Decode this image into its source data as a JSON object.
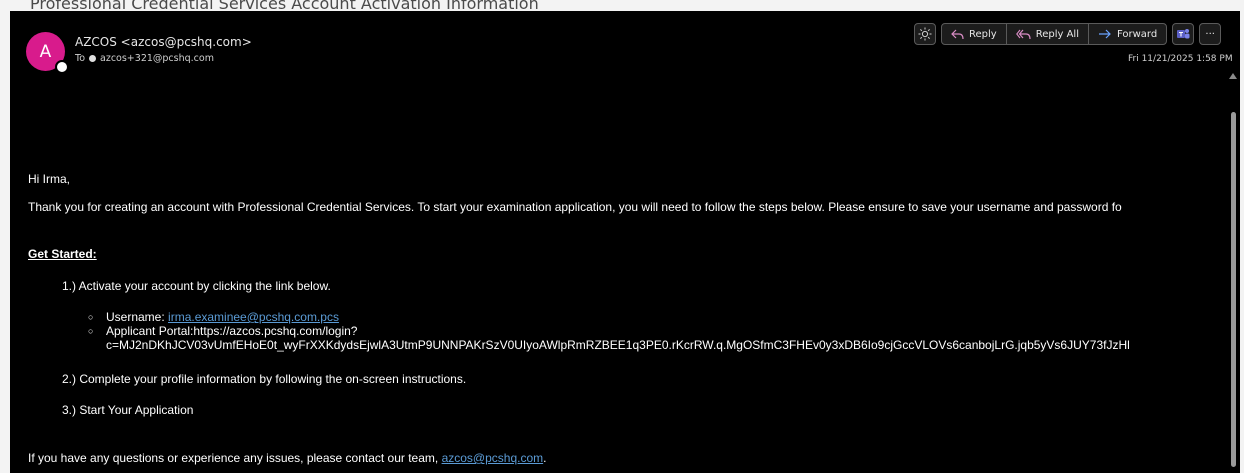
{
  "window_title": "Professional Credential Services Account Activation Information",
  "header": {
    "avatar_letter": "A",
    "from": "AZCOS <azcos@pcshq.com>",
    "to_label": "To",
    "to_address": "azcos+321@pcshq.com",
    "date": "Fri 11/21/2025 1:58 PM"
  },
  "toolbar": {
    "reply": "Reply",
    "reply_all": "Reply All",
    "forward": "Forward",
    "more": "···"
  },
  "body": {
    "greeting": "Hi Irma,",
    "intro": "Thank you for creating an account with Professional Credential Services. To start your examination application, you will need to follow the steps below. Please ensure to save your username and password fo",
    "get_started": "Get Started:",
    "step1": "1.) Activate your account by clicking the link below.",
    "username_label": "Username: ",
    "username_link": "irma.examinee@pcshq.com.pcs",
    "portal_line1": "Applicant Portal:https://azcos.pcshq.com/login?",
    "portal_line2": "c=MJ2nDKhJCV03vUmfEHoE0t_wyFrXXKdydsEjwlA3UtmP9UNNPAKrSzV0UIyoAWlpRmRZBEE1q3PE0.rKcrRW.q.MgOSfmC3FHEv0y3xDB6Io9cjGccVLOVs6canbojLrG.jqb5yVs6JUY73fJzHl",
    "step2": "2.) Complete your profile information by following the on-screen instructions.",
    "step3": "3.) Start Your Application",
    "contact_text": "If you have any questions or experience any issues, please contact our team, ",
    "contact_link": "azcos@pcshq.com",
    "contact_end": "."
  },
  "colors": {
    "avatar": "#d81b8c",
    "link": "#5b9bd5",
    "accent": "#3b82f6"
  }
}
